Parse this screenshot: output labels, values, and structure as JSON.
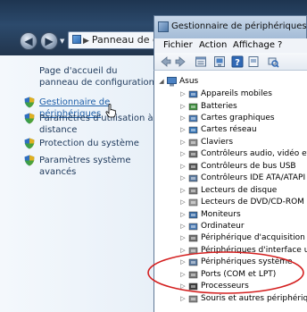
{
  "control_panel": {
    "address": "Panneau de cor",
    "nav_back_icon": "back-arrow-icon",
    "nav_forward_icon": "forward-arrow-icon",
    "home_link": "Page d'accueil du panneau de configuration",
    "links": [
      {
        "label": "Gestionnaire de périphériques",
        "icon": "shield-icon",
        "highlighted": true
      },
      {
        "label": "Paramètres d'utilisation à distance",
        "icon": "shield-icon"
      },
      {
        "label": "Protection du système",
        "icon": "shield-icon"
      },
      {
        "label": "Paramètres système avancés",
        "icon": "shield-icon"
      }
    ]
  },
  "device_manager": {
    "title": "Gestionnaire de périphériques",
    "menus": [
      "Fichier",
      "Action",
      "Affichage",
      "?"
    ],
    "toolbar_icons": [
      "back-icon",
      "forward-icon",
      "properties-icon",
      "computer-icon",
      "help-icon",
      "scan-icon"
    ],
    "tree": {
      "root": "Asus",
      "children": [
        {
          "label": "Appareils mobiles",
          "icon": "phone-icon",
          "color": "#3a6fb0"
        },
        {
          "label": "Batteries",
          "icon": "battery-icon",
          "color": "#3f8f3f"
        },
        {
          "label": "Cartes graphiques",
          "icon": "display-adapter-icon",
          "color": "#4a7bb5"
        },
        {
          "label": "Cartes réseau",
          "icon": "network-icon",
          "color": "#3a78b8"
        },
        {
          "label": "Claviers",
          "icon": "keyboard-icon",
          "color": "#8b8b8b"
        },
        {
          "label": "Contrôleurs audio, vidéo et jeu",
          "icon": "audio-icon",
          "color": "#6b6b6b"
        },
        {
          "label": "Contrôleurs de bus USB",
          "icon": "usb-icon",
          "color": "#555555"
        },
        {
          "label": "Contrôleurs IDE ATA/ATAPI",
          "icon": "ide-icon",
          "color": "#5b7aa0"
        },
        {
          "label": "Lecteurs de disque",
          "icon": "disk-icon",
          "color": "#7a7a7a"
        },
        {
          "label": "Lecteurs de DVD/CD-ROM",
          "icon": "dvd-icon",
          "color": "#9a9a9a"
        },
        {
          "label": "Moniteurs",
          "icon": "monitor-icon",
          "color": "#3b6ea8"
        },
        {
          "label": "Ordinateur",
          "icon": "computer-icon",
          "color": "#4a7bb5"
        },
        {
          "label": "Périphérique d'acquisition d'in",
          "icon": "camera-icon",
          "color": "#6f6f6f"
        },
        {
          "label": "Périphériques d'interface utilis",
          "icon": "hid-icon",
          "color": "#8a8a8a"
        },
        {
          "label": "Périphériques système",
          "icon": "system-icon",
          "color": "#5b7aa0"
        },
        {
          "label": "Ports (COM et LPT)",
          "icon": "port-icon",
          "color": "#777777"
        },
        {
          "label": "Processeurs",
          "icon": "cpu-icon",
          "color": "#3d3d3d"
        },
        {
          "label": "Souris et autres périphériques",
          "icon": "mouse-icon",
          "color": "#888888"
        }
      ]
    }
  },
  "colors": {
    "annotation": "#d42020",
    "link": "#1e395b",
    "link_hover": "#1d5ea8"
  }
}
